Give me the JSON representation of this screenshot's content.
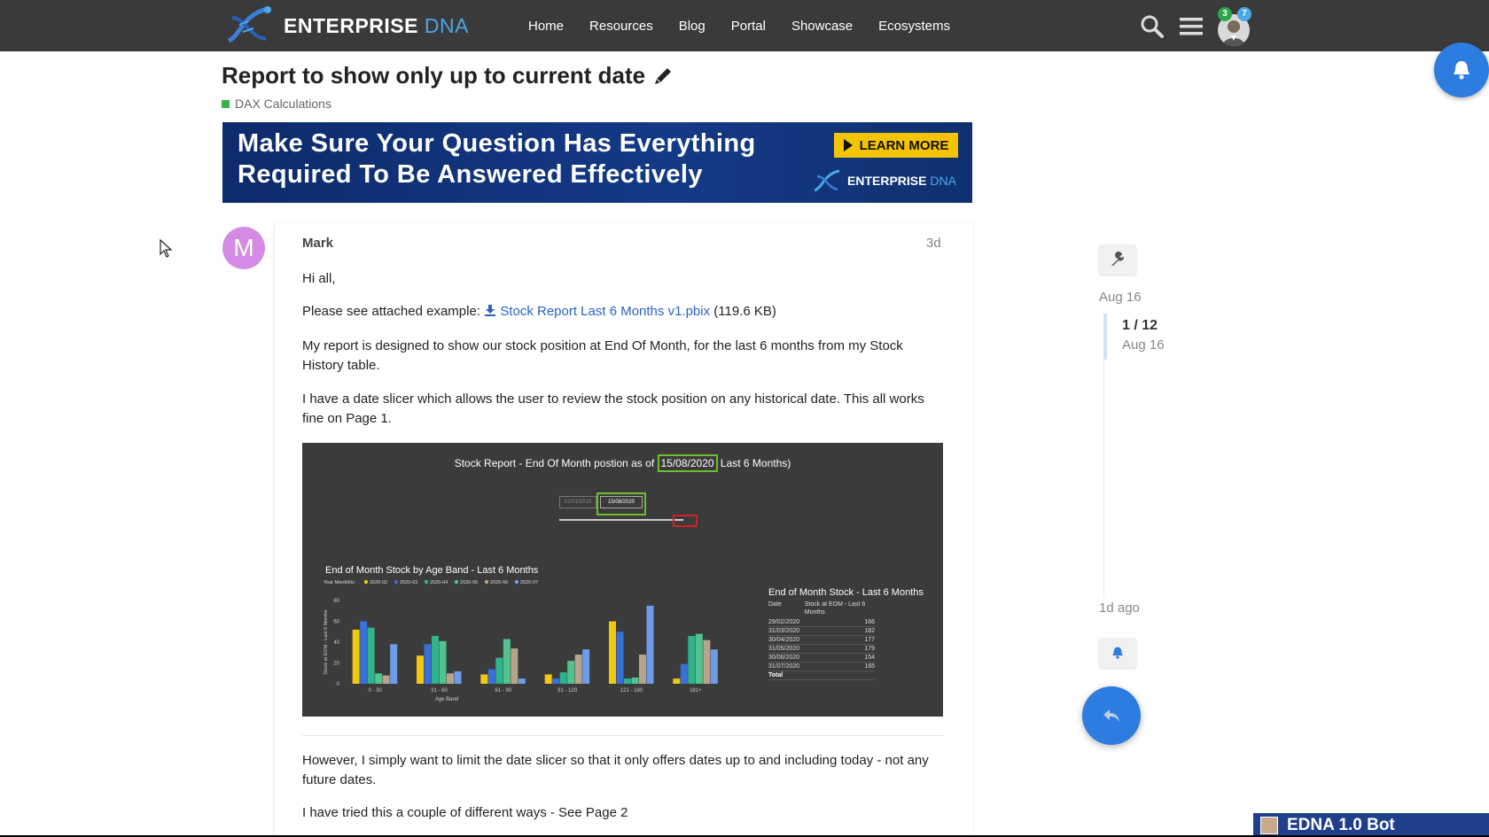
{
  "header": {
    "logo_text": "ENTERPRISE",
    "logo_text_accent": "DNA",
    "nav": [
      "Home",
      "Resources",
      "Blog",
      "Portal",
      "Showcase",
      "Ecosystems"
    ],
    "notification_badge_green": "3",
    "notification_badge_blue": "7"
  },
  "topic": {
    "title": "Report to show only up to current date",
    "category": "DAX Calculations",
    "category_color": "#3ab14a"
  },
  "banner": {
    "line1": "Make Sure Your Question Has Everything",
    "line2": "Required To Be Answered Effectively",
    "cta": "LEARN MORE",
    "logo_text": "ENTERPRISE",
    "logo_accent": "DNA"
  },
  "post": {
    "avatar_letter": "M",
    "author": "Mark",
    "age": "3d",
    "greeting": "Hi all,",
    "attach_prefix": "Please see attached example:",
    "attach_name": "Stock Report Last 6 Months v1.pbix",
    "attach_size": "(119.6 KB)",
    "para1": "My report is designed to show our stock position at End Of Month, for the last 6 months from my Stock History table.",
    "para2": "I have a date slicer which allows the user to review the stock position on any historical date. This all works fine on Page 1.",
    "para3": "However, I simply want to limit the date slicer so that it only offers dates up to and including today - not any future dates.",
    "para4": "I have tried this a couple of different ways - See Page 2"
  },
  "embedded_report": {
    "title_prefix": "Stock Report - End Of Month postion as of",
    "title_date": "15/08/2020",
    "title_suffix": "Last 6 Months)",
    "slicer_start": "01/01/2018",
    "slicer_end": "15/08/2020",
    "chart_title": "End of Month Stock by Age Band - Last 6 Months",
    "legend_label": "Year MonthNo",
    "legend": [
      "2020-02",
      "2020-03",
      "2020-04",
      "2020-05",
      "2020-06",
      "2020-07"
    ],
    "ylabel": "Stock at EOM - Last 6 Months",
    "xlabel": "Age Band",
    "table_title": "End of Month Stock - Last 6 Months",
    "table_headers": [
      "Date",
      "Stock at EOM - Last 6 Months"
    ],
    "table_rows": [
      [
        "29/02/2020",
        "166"
      ],
      [
        "31/03/2020",
        "182"
      ],
      [
        "30/04/2020",
        "177"
      ],
      [
        "31/05/2020",
        "179"
      ],
      [
        "30/06/2020",
        "154"
      ],
      [
        "31/07/2020",
        "165"
      ]
    ],
    "table_total": "Total"
  },
  "chart_data": {
    "type": "bar",
    "title": "End of Month Stock by Age Band - Last 6 Months",
    "xlabel": "Age Band",
    "ylabel": "Stock at EOM - Last 6 Months",
    "categories": [
      "0 - 30",
      "31 - 60",
      "61 - 90",
      "91 - 120",
      "121 - 180",
      "181+"
    ],
    "ylim": [
      0,
      80
    ],
    "yticks": [
      0,
      20,
      40,
      60,
      80
    ],
    "series": [
      {
        "name": "2020-02",
        "color": "#f2c811",
        "values": [
          52,
          27,
          9,
          9,
          60,
          5
        ]
      },
      {
        "name": "2020-03",
        "color": "#3a6fd8",
        "values": [
          60,
          38,
          14,
          5,
          50,
          19
        ]
      },
      {
        "name": "2020-04",
        "color": "#2fb38a",
        "values": [
          54,
          46,
          25,
          11,
          5,
          46
        ]
      },
      {
        "name": "2020-05",
        "color": "#4fc48e",
        "values": [
          10,
          41,
          43,
          22,
          6,
          48
        ]
      },
      {
        "name": "2020-06",
        "color": "#b8a38c",
        "values": [
          8,
          10,
          34,
          28,
          28,
          42
        ]
      },
      {
        "name": "2020-07",
        "color": "#6e9ce8",
        "values": [
          38,
          12,
          5,
          33,
          75,
          33
        ]
      }
    ]
  },
  "timeline": {
    "top_date": "Aug 16",
    "count": "1 / 12",
    "count_date": "Aug 16",
    "ago": "1d ago"
  },
  "bot": {
    "label": "EDNA 1.0 Bot"
  }
}
